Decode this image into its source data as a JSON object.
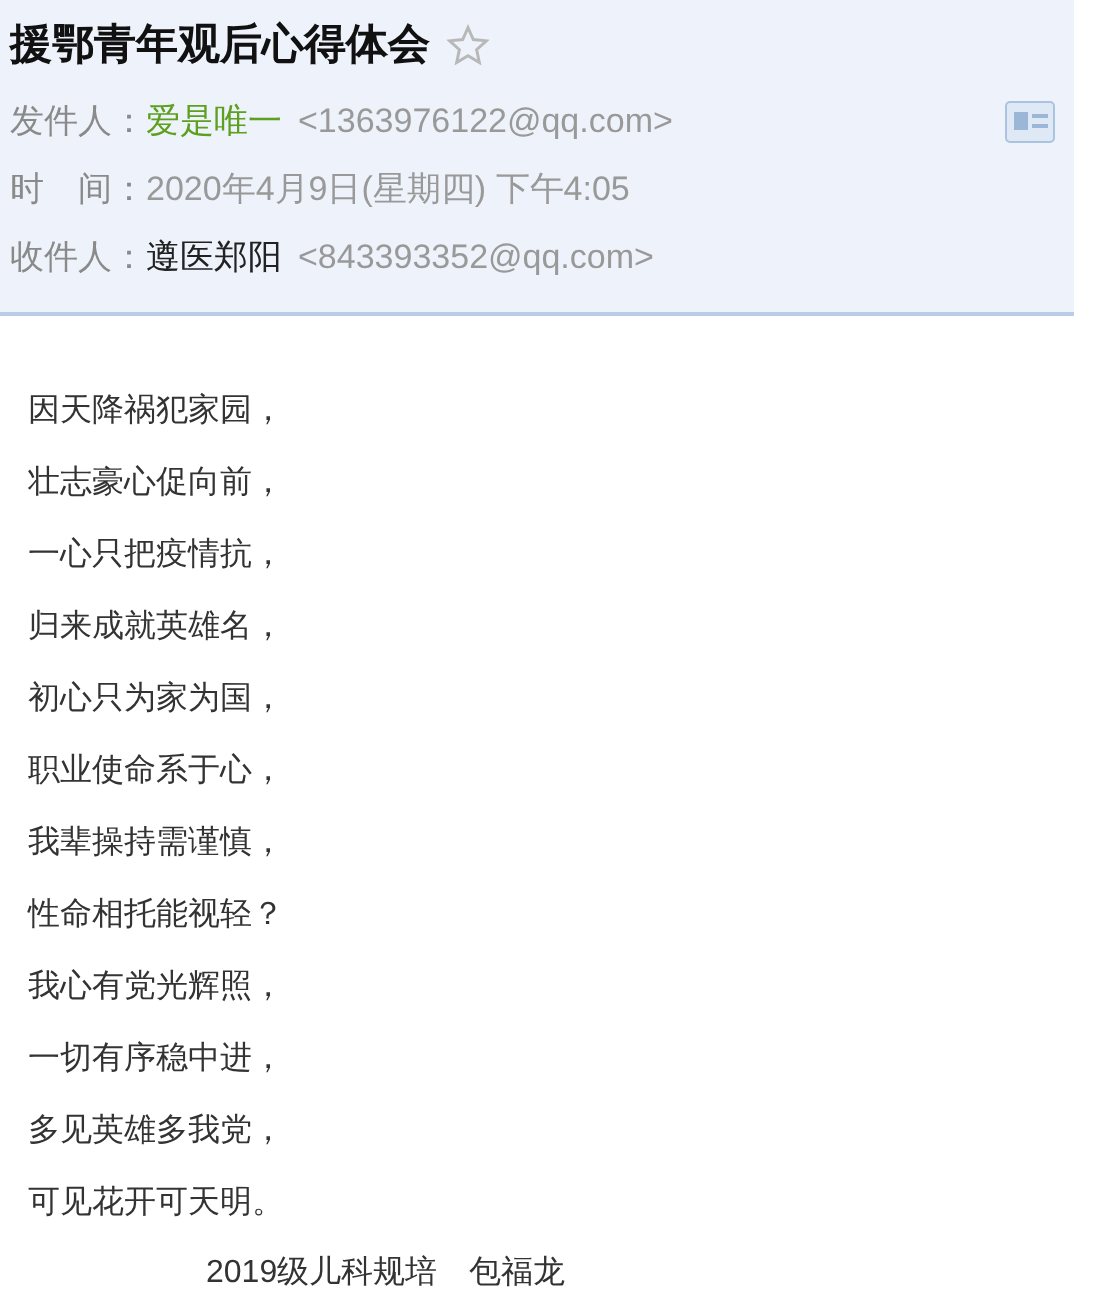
{
  "subject": "援鄂青年观后心得体会",
  "starred": false,
  "fields": [
    {
      "kind": "sender",
      "label": "发件人：",
      "name": "爱是唯一",
      "email": "<1363976122@qq.com>"
    },
    {
      "kind": "time",
      "label": "时　间：",
      "value": "2020年4月9日(星期四) 下午4:05"
    },
    {
      "kind": "recipient",
      "label": "收件人：",
      "name": "遵医郑阳",
      "email": "<843393352@qq.com>"
    }
  ],
  "body_lines": [
    "因天降祸犯家园，",
    "壮志豪心促向前，",
    "一心只把疫情抗，",
    "归来成就英雄名，",
    "初心只为家为国，",
    "职业使命系于心，",
    "我辈操持需谨慎，",
    "性命相托能视轻？",
    "我心有党光辉照，",
    "一切有序稳中进，",
    "多见英雄多我党，",
    "可见花开可天明。"
  ],
  "signature": "2019级儿科规培　包福龙"
}
